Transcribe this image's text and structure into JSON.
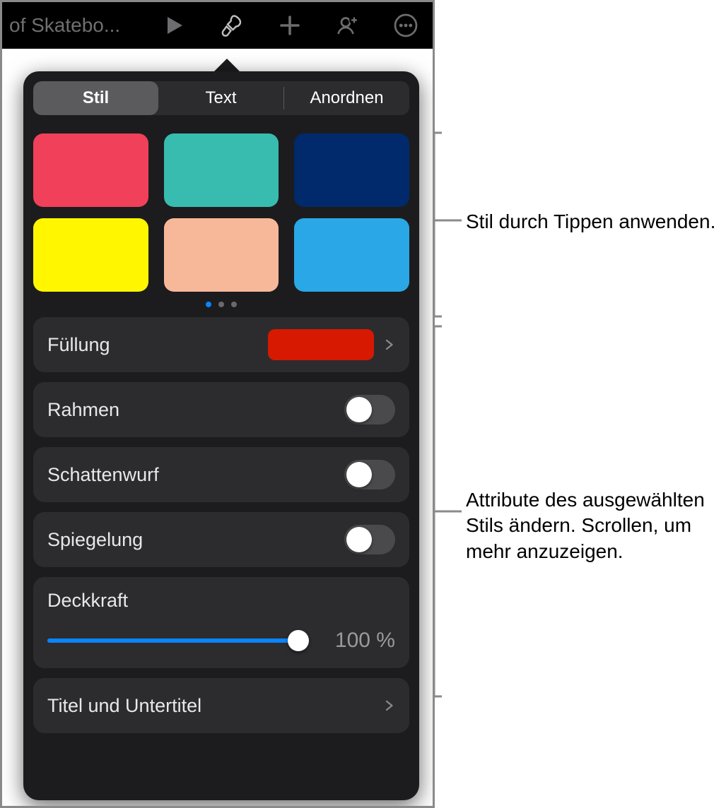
{
  "toolbar": {
    "doc_title": "of Skatebo..."
  },
  "popover": {
    "tabs": {
      "t0": "Stil",
      "t1": "Text",
      "t2": "Anordnen"
    },
    "swatch_colors": [
      "#f0405a",
      "#38bcb0",
      "#002a6b",
      "#fff600",
      "#f7b89a",
      "#2aa7e6"
    ],
    "page_dots": {
      "count": 3,
      "active": 0
    },
    "fill": {
      "label": "Füllung",
      "swatch": "#d61900"
    },
    "border": {
      "label": "Rahmen"
    },
    "shadow": {
      "label": "Schattenwurf"
    },
    "reflect": {
      "label": "Spiegelung"
    },
    "opacity": {
      "label": "Deckkraft",
      "value": "100 %"
    },
    "title": {
      "label": "Titel und Untertitel"
    }
  },
  "annotations": {
    "a1": "Stil durch Tippen anwenden.",
    "a2": "Attribute des ausgewählten Stils ändern. Scrollen, um mehr anzuzeigen."
  }
}
